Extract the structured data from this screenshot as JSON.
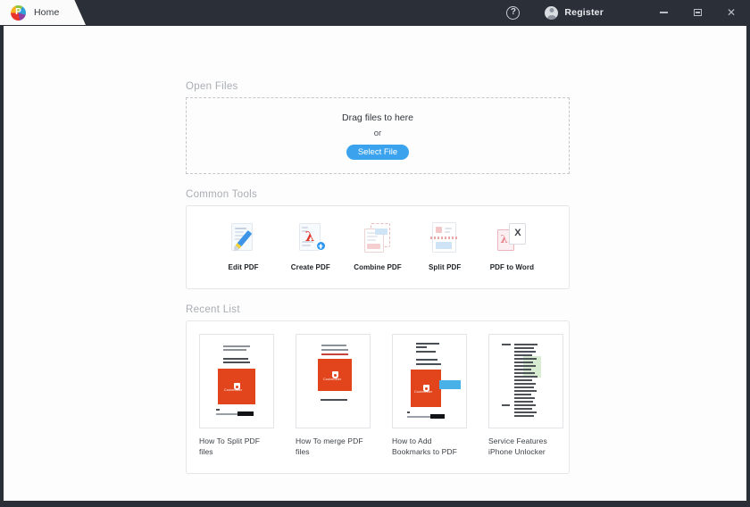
{
  "window": {
    "tab_label": "Home",
    "logo_icon": "pdf-app-logo-icon",
    "help_icon": "help-circle-icon",
    "register_label": "Register",
    "avatar_icon": "user-avatar-icon",
    "minimize_label": "Minimize",
    "maximize_label": "Restore",
    "close_label": "Close",
    "titlebar_color": "#2b2f38"
  },
  "open_files": {
    "section_title": "Open Files",
    "drag_text": "Drag files to here",
    "or_text": "or",
    "select_file_label": "Select File",
    "button_color": "#3ba3ee"
  },
  "common_tools": {
    "section_title": "Common Tools",
    "tools": [
      {
        "label": "Edit PDF",
        "icon": "document-pencil-icon"
      },
      {
        "label": "Create PDF",
        "icon": "pdf-plus-badge-icon"
      },
      {
        "label": "Combine PDF",
        "icon": "two-pages-merge-icon"
      },
      {
        "label": "Split PDF",
        "icon": "page-split-dashed-icon"
      },
      {
        "label": "PDF to Word",
        "icon": "pdf-to-word-icon"
      }
    ]
  },
  "recent_list": {
    "section_title": "Recent List",
    "items": [
      {
        "label": "How To Split PDF files",
        "thumbnail": "document-thumbnail-split"
      },
      {
        "label": "How To merge PDF files",
        "thumbnail": "document-thumbnail-merge"
      },
      {
        "label": "How to Add Bookmarks to PDF",
        "thumbnail": "document-thumbnail-bookmarks"
      },
      {
        "label": "Service Features iPhone Unlocker",
        "thumbnail": "document-thumbnail-dense-text"
      }
    ]
  }
}
